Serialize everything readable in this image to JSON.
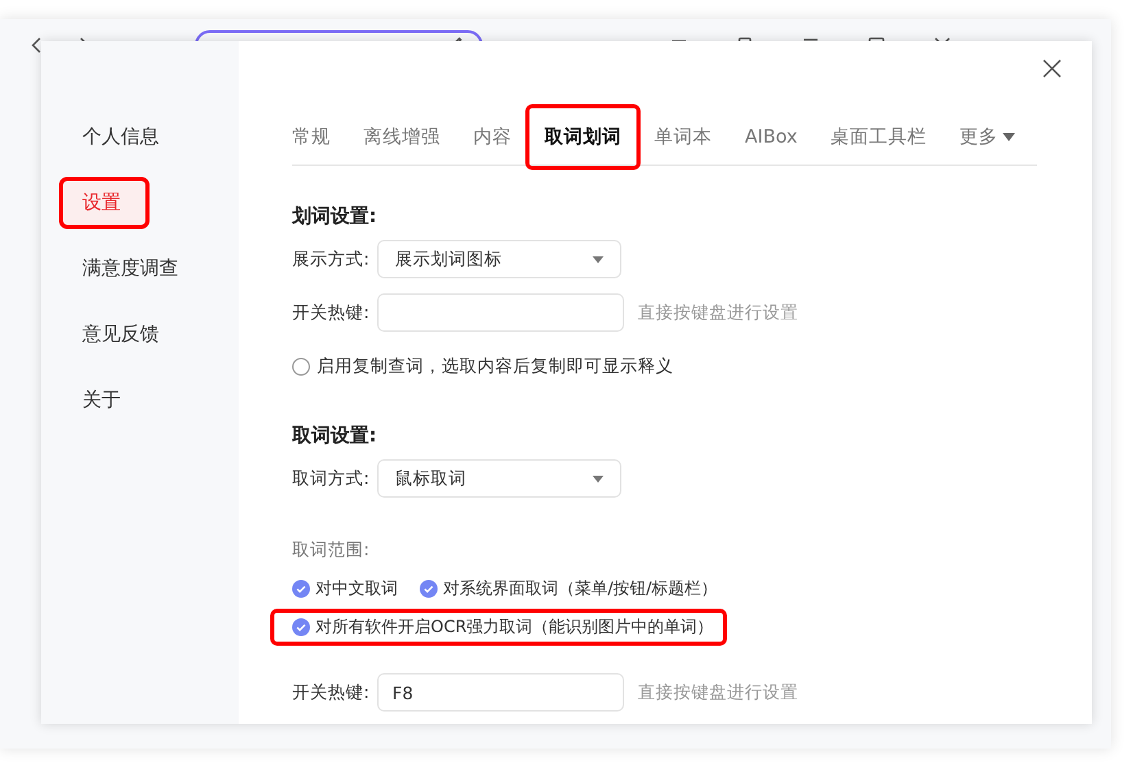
{
  "dialog": {
    "sidebar": {
      "items": [
        {
          "label": "个人信息",
          "selected": false,
          "highlighted": false
        },
        {
          "label": "设置",
          "selected": true,
          "highlighted": true
        },
        {
          "label": "满意度调查",
          "selected": false,
          "highlighted": false
        },
        {
          "label": "意见反馈",
          "selected": false,
          "highlighted": false
        },
        {
          "label": "关于",
          "selected": false,
          "highlighted": false
        }
      ]
    },
    "tabs": [
      {
        "label": "常规",
        "selected": false,
        "highlighted": false
      },
      {
        "label": "离线增强",
        "selected": false,
        "highlighted": false
      },
      {
        "label": "内容",
        "selected": false,
        "highlighted": false
      },
      {
        "label": "取词划词",
        "selected": true,
        "highlighted": true
      },
      {
        "label": "单词本",
        "selected": false,
        "highlighted": false
      },
      {
        "label": "AIBox",
        "selected": false,
        "highlighted": false
      },
      {
        "label": "桌面工具栏",
        "selected": false,
        "highlighted": false
      }
    ],
    "more_tab": "更多",
    "sections": [
      {
        "title": "划词设置:",
        "rows": [
          {
            "kind": "select",
            "label": "展示方式:",
            "value": "展示划词图标"
          },
          {
            "kind": "hotkey",
            "label": "开关热键:",
            "value": "",
            "hint": "直接按键盘进行设置"
          },
          {
            "kind": "radio",
            "label": "启用复制查词，选取内容后复制即可显示释义",
            "checked": false
          }
        ]
      },
      {
        "title": "取词设置:",
        "rows": [
          {
            "kind": "select",
            "label": "取词方式:",
            "value": "鼠标取词"
          },
          {
            "kind": "caption",
            "label": "取词范围:"
          },
          {
            "kind": "checks",
            "items": [
              {
                "label": "对中文取词",
                "checked": true,
                "highlighted": false
              },
              {
                "label": "对系统界面取词（菜单/按钮/标题栏）",
                "checked": true,
                "highlighted": false
              }
            ]
          },
          {
            "kind": "checks",
            "items": [
              {
                "label": "对所有软件开启OCR强力取词（能识别图片中的单词）",
                "checked": true,
                "highlighted": true
              }
            ]
          },
          {
            "kind": "hotkey",
            "label": "开关热键:",
            "value": "F8",
            "hint": "直接按键盘进行设置"
          }
        ]
      }
    ]
  }
}
